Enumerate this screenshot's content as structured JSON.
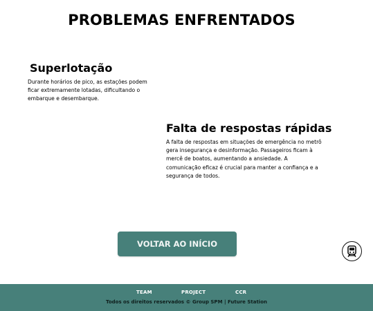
{
  "page": {
    "title": "PROBLEMAS ENFRENTADOS"
  },
  "problems": [
    {
      "title": "Superlotação",
      "text": "Durante horários de pico, as estações podem ficar extremamente lotadas, dificultando o embarque e desembarque."
    },
    {
      "title": "Falta de respostas rápidas",
      "text": "A falta de respostas em situações de emergência no metrô gera insegurança e desinformação. Passageiros ficam à mercê de boatos, aumentando a ansiedade. A comunicação eficaz é crucial para manter a confiança e a segurança de todos."
    }
  ],
  "actions": {
    "back_label": "VOLTAR AO INÍCIO",
    "train_icon": "train-icon"
  },
  "footer": {
    "links": [
      "TEAM",
      "PROJECT",
      "CCR"
    ],
    "copyright": "Todos os direitos reservados © Group SPM | Future Station"
  },
  "colors": {
    "accent": "#47807a",
    "background": "#ffffff",
    "text": "#000000"
  }
}
